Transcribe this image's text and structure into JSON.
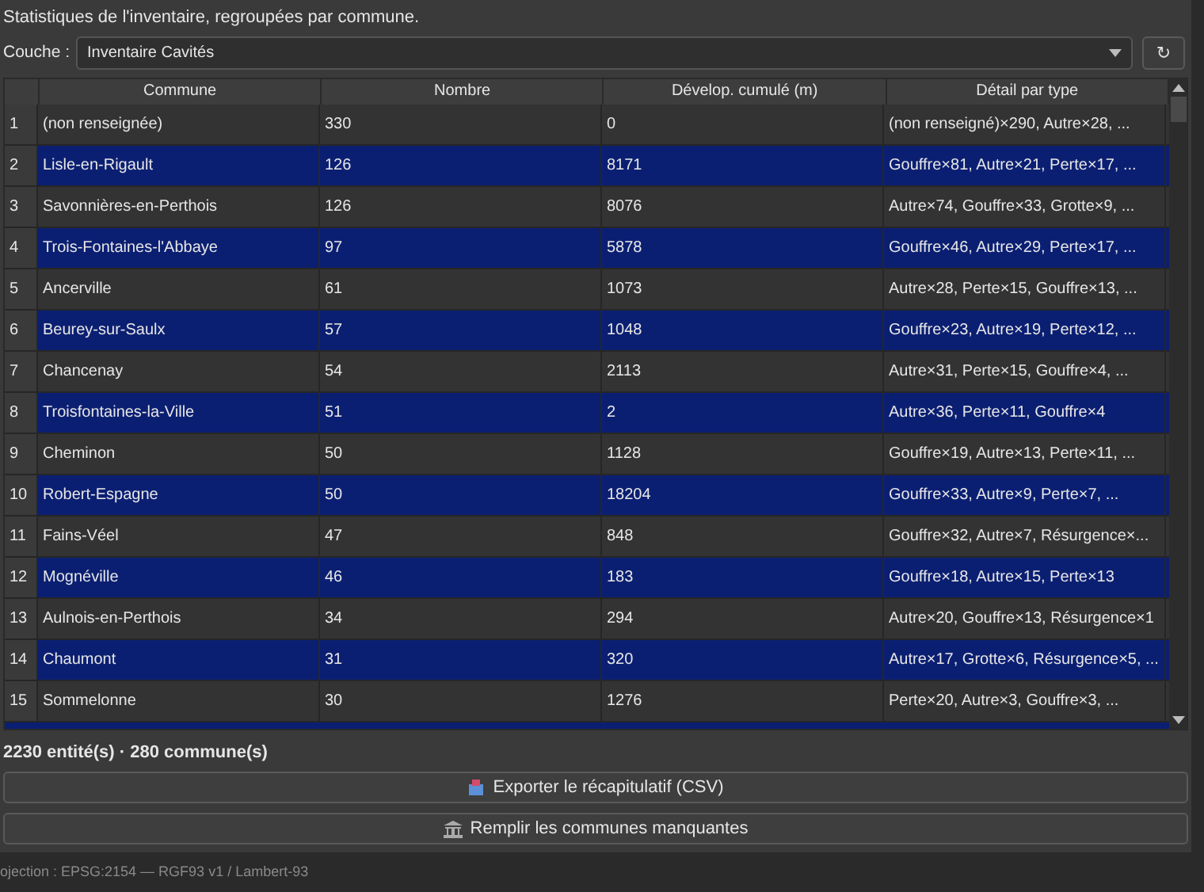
{
  "description": "Statistiques de l'inventaire, regroupées par commune.",
  "layer": {
    "label": "Couche :",
    "value": "Inventaire Cavités"
  },
  "refresh_button": {
    "label": "↻"
  },
  "table": {
    "columns": [
      "Commune",
      "Nombre",
      "Dévelop. cumulé (m)",
      "Détail par type"
    ],
    "rows": [
      {
        "index": "1",
        "cells": [
          "(non renseignée)",
          "330",
          "0",
          "(non renseigné)×290, Autre×28, ..."
        ]
      },
      {
        "index": "2",
        "cells": [
          "Lisle-en-Rigault",
          "126",
          "8171",
          "Gouffre×81, Autre×21, Perte×17, ..."
        ]
      },
      {
        "index": "3",
        "cells": [
          "Savonnières-en-Perthois",
          "126",
          "8076",
          "Autre×74, Gouffre×33, Grotte×9, ..."
        ]
      },
      {
        "index": "4",
        "cells": [
          "Trois-Fontaines-l'Abbaye",
          "97",
          "5878",
          "Gouffre×46, Autre×29, Perte×17, ..."
        ]
      },
      {
        "index": "5",
        "cells": [
          "Ancerville",
          "61",
          "1073",
          "Autre×28, Perte×15, Gouffre×13, ..."
        ]
      },
      {
        "index": "6",
        "cells": [
          "Beurey-sur-Saulx",
          "57",
          "1048",
          "Gouffre×23, Autre×19, Perte×12, ..."
        ]
      },
      {
        "index": "7",
        "cells": [
          "Chancenay",
          "54",
          "2113",
          "Autre×31, Perte×15, Gouffre×4, ..."
        ]
      },
      {
        "index": "8",
        "cells": [
          "Troisfontaines-la-Ville",
          "51",
          "2",
          "Autre×36, Perte×11, Gouffre×4"
        ]
      },
      {
        "index": "9",
        "cells": [
          "Cheminon",
          "50",
          "1128",
          "Gouffre×19, Autre×13, Perte×11, ..."
        ]
      },
      {
        "index": "10",
        "cells": [
          "Robert-Espagne",
          "50",
          "18204",
          "Gouffre×33, Autre×9, Perte×7, ..."
        ]
      },
      {
        "index": "11",
        "cells": [
          "Fains-Véel",
          "47",
          "848",
          "Gouffre×32, Autre×7, Résurgence×..."
        ]
      },
      {
        "index": "12",
        "cells": [
          "Mognéville",
          "46",
          "183",
          "Gouffre×18, Autre×15, Perte×13"
        ]
      },
      {
        "index": "13",
        "cells": [
          "Aulnois-en-Perthois",
          "34",
          "294",
          "Autre×20, Gouffre×13, Résurgence×1"
        ]
      },
      {
        "index": "14",
        "cells": [
          "Chaumont",
          "31",
          "320",
          "Autre×17, Grotte×6, Résurgence×5, ..."
        ]
      },
      {
        "index": "15",
        "cells": [
          "Sommelonne",
          "30",
          "1276",
          "Perte×20, Autre×3, Gouffre×3, ..."
        ]
      }
    ]
  },
  "summary": "2230 entité(s) · 280 commune(s)",
  "buttons": [
    {
      "label": "Exporter le récapitulatif (CSV)",
      "kind": "export"
    },
    {
      "label": "Remplir les communes manquantes",
      "kind": "fill"
    }
  ],
  "status_bar": "ojection : EPSG:2154 — RGF93 v1 / Lambert-93"
}
